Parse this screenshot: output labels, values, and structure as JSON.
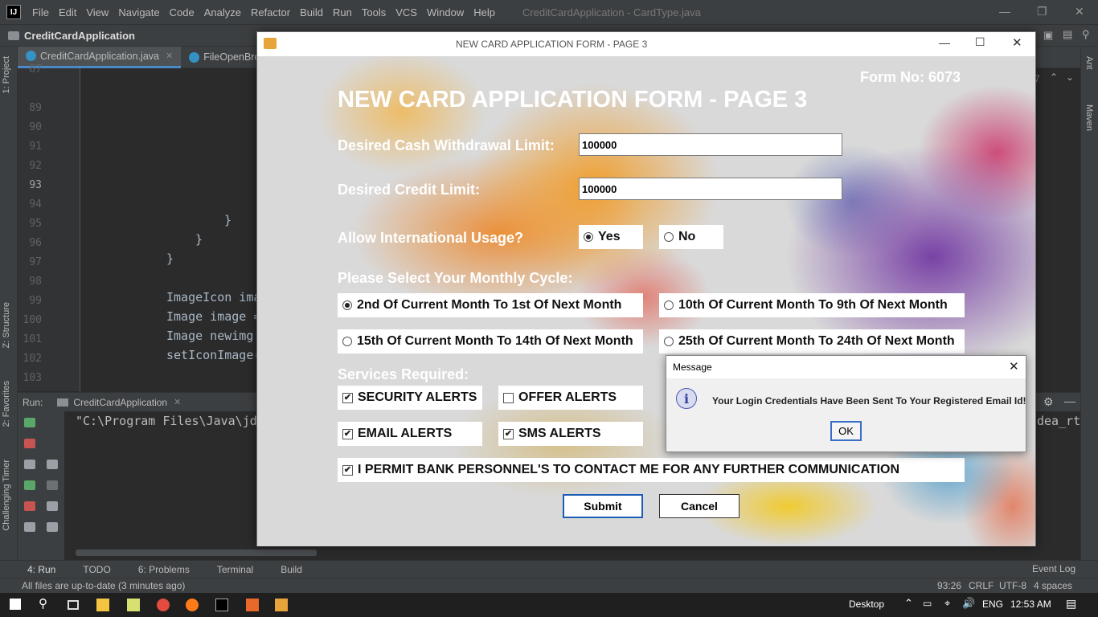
{
  "ide": {
    "menu": [
      "File",
      "Edit",
      "View",
      "Navigate",
      "Code",
      "Analyze",
      "Refactor",
      "Build",
      "Run",
      "Tools",
      "VCS",
      "Window",
      "Help"
    ],
    "window_title": "CreditCardApplication - CardType.java",
    "project_name": "CreditCardApplication",
    "editor_tabs": [
      "CreditCardApplication.java",
      "FileOpenBrows"
    ],
    "line_numbers": [
      "87",
      "89",
      "90",
      "91",
      "92",
      "93",
      "94",
      "95",
      "96",
      "97",
      "98",
      "99",
      "100",
      "101",
      "102",
      "103"
    ],
    "code_lines": {
      "l95": "}",
      "l96": "}",
      "l97": "}",
      "l99": "ImageIcon ima",
      "l100": "Image image =",
      "l101": "Image newimg",
      "l102": "setIconImage("
    },
    "left_tabs": [
      "1: Project",
      "Z: Structure",
      "2: Favorites",
      "Challenging Timer"
    ],
    "right_tabs": [
      "Ant",
      "Maven"
    ],
    "run_label": "Run:",
    "run_tab": "CreditCardApplication",
    "run_output": "\"C:\\Program Files\\Java\\jd",
    "run_output_right": "dea_rt",
    "tool_tabs": [
      "4: Run",
      "TODO",
      "6: Problems",
      "Terminal",
      "Build"
    ],
    "event_log": "Event Log",
    "status_message": "All files are up-to-date (3 minutes ago)",
    "status_right": {
      "position": "93:26",
      "line_sep": "CRLF",
      "encoding": "UTF-8",
      "indent": "4 spaces"
    },
    "editor_counter": "7"
  },
  "taskbar": {
    "desktop": "Desktop",
    "lang": "ENG",
    "time": "12:53 AM"
  },
  "form": {
    "window_title": "NEW CARD APPLICATION FORM - PAGE 3",
    "form_no": "Form No: 6073",
    "heading": "NEW CARD APPLICATION FORM - PAGE 3",
    "cash_label": "Desired Cash Withdrawal Limit:",
    "cash_value": "100000",
    "credit_label": "Desired Credit Limit:",
    "credit_value": "100000",
    "intl_label": "Allow International Usage?",
    "intl_yes": "Yes",
    "intl_no": "No",
    "intl_selected": "Yes",
    "cycle_label": "Please Select Your Monthly Cycle:",
    "cycles": [
      "2nd Of Current Month To 1st Of Next Month",
      "10th Of Current Month To 9th Of Next Month",
      "15th Of Current Month To 14th Of Next Month",
      "25th Of Current Month To 24th Of Next Month"
    ],
    "cycle_selected": "2nd Of Current Month To 1st Of Next Month",
    "services_label": "Services Required:",
    "services": [
      {
        "label": "SECURITY ALERTS",
        "checked": true
      },
      {
        "label": "OFFER ALERTS",
        "checked": false
      },
      {
        "label": "EMAIL ALERTS",
        "checked": true
      },
      {
        "label": "SMS ALERTS",
        "checked": true
      }
    ],
    "permit_label": "I PERMIT BANK PERSONNEL'S TO CONTACT ME FOR ANY FURTHER COMMUNICATION",
    "permit_checked": true,
    "submit": "Submit",
    "cancel": "Cancel"
  },
  "dialog": {
    "title": "Message",
    "text": "Your Login Credentials Have Been Sent To Your Registered Email Id!",
    "ok": "OK"
  },
  "colors": {
    "ide_bg": "#2b2b2b",
    "accent": "#4a88c7",
    "form_bg": "#d9d9d9"
  }
}
